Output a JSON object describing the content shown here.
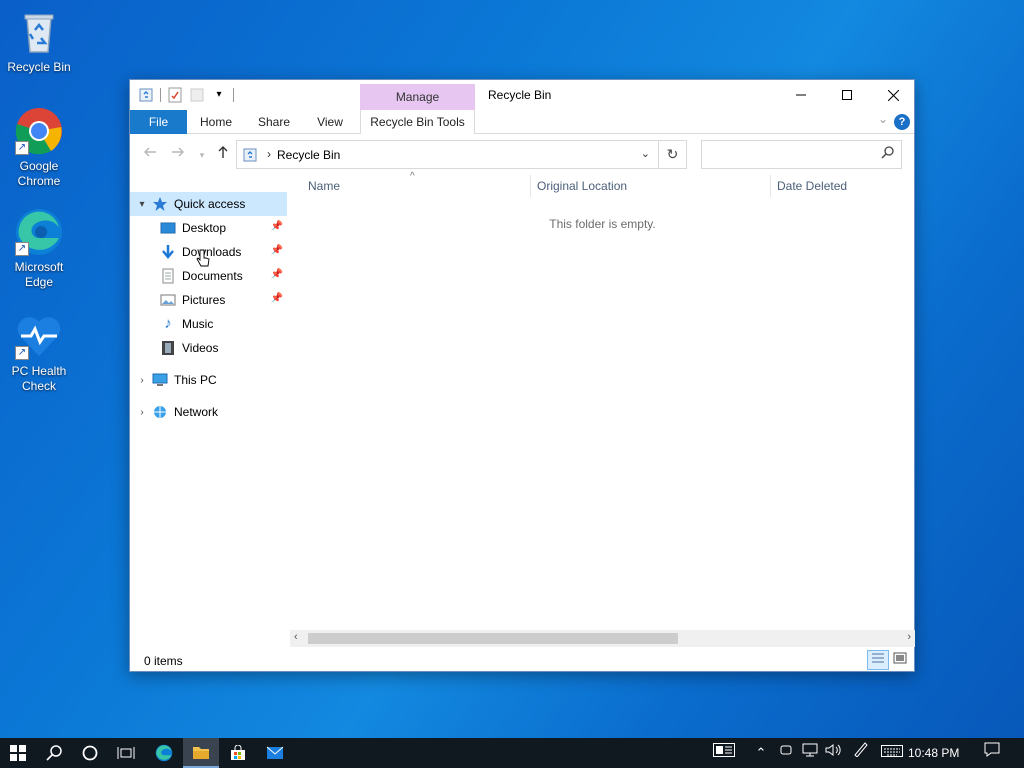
{
  "desktop": {
    "icons": [
      {
        "label": "Recycle Bin",
        "icon": "recycle-bin-icon"
      },
      {
        "label": "Google Chrome",
        "icon": "chrome-icon"
      },
      {
        "label": "Microsoft Edge",
        "icon": "edge-icon"
      },
      {
        "label": "PC Health Check",
        "icon": "health-check-icon"
      }
    ]
  },
  "window": {
    "title": "Recycle Bin",
    "manage_tab": "Manage",
    "tabs": {
      "file": "File",
      "home": "Home",
      "share": "Share",
      "view": "View",
      "tools": "Recycle Bin Tools"
    },
    "help": "?",
    "address": {
      "crumb": "Recycle Bin",
      "search_placeholder": ""
    },
    "nav_pane": {
      "quick_access": "Quick access",
      "items": [
        {
          "label": "Desktop",
          "pinned": true
        },
        {
          "label": "Downloads",
          "pinned": true
        },
        {
          "label": "Documents",
          "pinned": true
        },
        {
          "label": "Pictures",
          "pinned": true
        },
        {
          "label": "Music",
          "pinned": false
        },
        {
          "label": "Videos",
          "pinned": false
        }
      ],
      "this_pc": "This PC",
      "network": "Network"
    },
    "columns": [
      "Name",
      "Original Location",
      "Date Deleted"
    ],
    "empty_message": "This folder is empty.",
    "status": "0 items"
  },
  "taskbar": {
    "clock": "10:48 PM"
  },
  "colors": {
    "accent": "#1979ca",
    "manage_tab": "#e7c7f2",
    "selected_nav": "#cce8ff",
    "taskbar": "#101820"
  }
}
